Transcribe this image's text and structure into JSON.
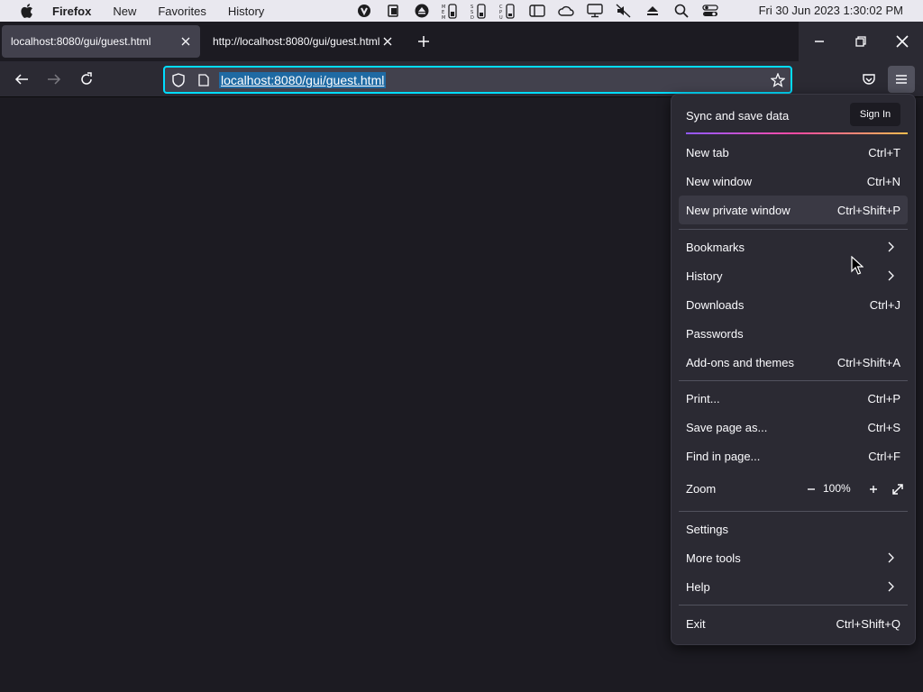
{
  "menubar": {
    "app_name": "Firefox",
    "items": [
      "New",
      "Favorites",
      "History"
    ],
    "clock": "Fri 30 Jun 2023  1:30:02 PM",
    "status_icons": [
      "vpn-icon",
      "clipboard-icon",
      "eject-circle-icon",
      "memory-icon",
      "ssd-icon",
      "cpu-icon",
      "sidebar-icon",
      "cloud-icon",
      "display-icon",
      "mute-icon",
      "eject-icon",
      "search-icon",
      "control-center-icon"
    ]
  },
  "tabs": [
    {
      "title": "localhost:8080/gui/guest.html",
      "active": true
    },
    {
      "title": "http://localhost:8080/gui/guest.html",
      "active": false
    }
  ],
  "urlbar": {
    "url": "localhost:8080/gui/guest.html"
  },
  "app_menu": {
    "sync_label": "Sync and save data",
    "signin_label": "Sign In",
    "items": [
      {
        "label": "New tab",
        "shortcut": "Ctrl+T"
      },
      {
        "label": "New window",
        "shortcut": "Ctrl+N"
      },
      {
        "label": "New private window",
        "shortcut": "Ctrl+Shift+P"
      },
      {
        "label": "Bookmarks",
        "shortcut": ""
      },
      {
        "label": "History",
        "shortcut": ""
      },
      {
        "label": "Downloads",
        "shortcut": "Ctrl+J"
      },
      {
        "label": "Passwords",
        "shortcut": ""
      },
      {
        "label": "Add-ons and themes",
        "shortcut": "Ctrl+Shift+A"
      },
      {
        "label": "Print...",
        "shortcut": "Ctrl+P"
      },
      {
        "label": "Save page as...",
        "shortcut": "Ctrl+S"
      },
      {
        "label": "Find in page...",
        "shortcut": "Ctrl+F"
      },
      {
        "label": "Zoom",
        "shortcut": ""
      },
      {
        "label": "Settings",
        "shortcut": ""
      },
      {
        "label": "More tools",
        "shortcut": ""
      },
      {
        "label": "Help",
        "shortcut": ""
      },
      {
        "label": "Exit",
        "shortcut": "Ctrl+Shift+Q"
      }
    ],
    "zoom_value": "100%"
  },
  "colors": {
    "accent_focus": "#00ddff",
    "panel_bg": "#2b2a33",
    "page_bg": "#1c1b22"
  }
}
